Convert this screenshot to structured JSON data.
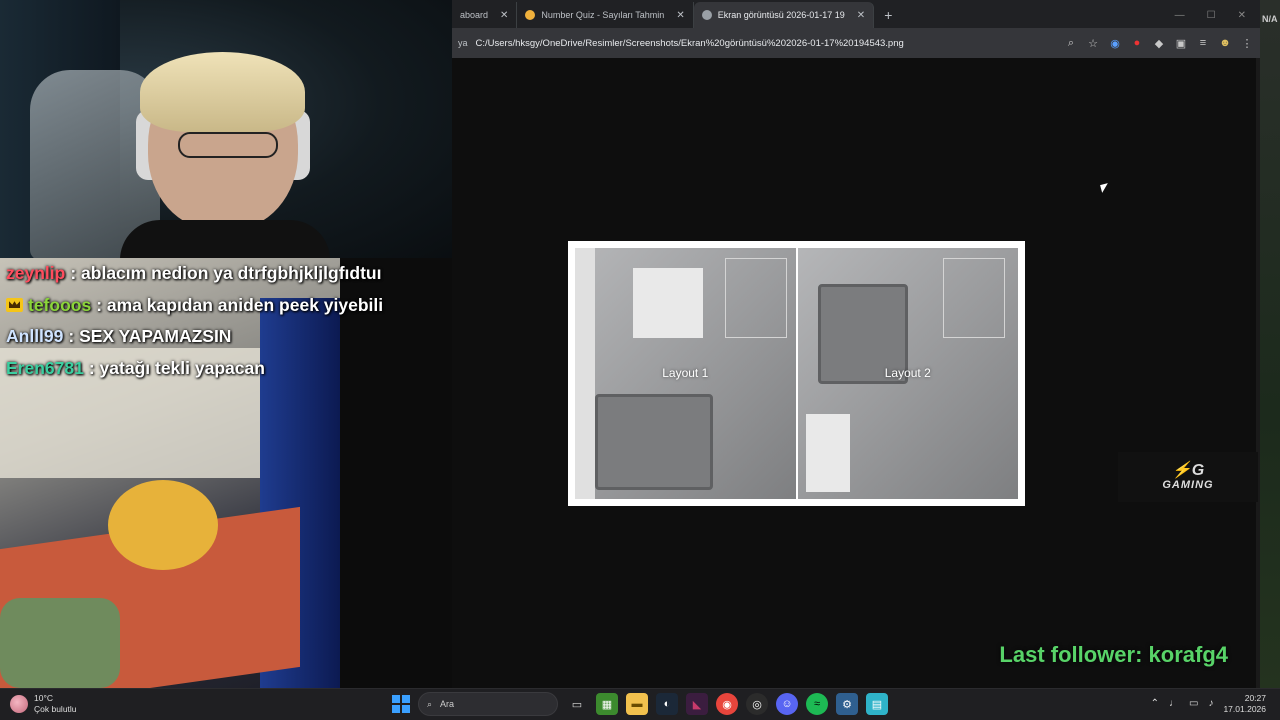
{
  "chat": [
    {
      "user": "zeynlip",
      "color": "#ff4d5e",
      "separator": ":",
      "message": "ablacım nedion ya dtrfgbhjkljlgfıdtuı",
      "badge": false
    },
    {
      "user": "tefooos",
      "color": "#8bd53a",
      "separator": ":",
      "message": "ama kapıdan aniden peek yiyebili",
      "badge": true
    },
    {
      "user": "Anlll99",
      "color": "#cfe3ff",
      "separator": ":",
      "message": "SEX YAPAMAZSIN",
      "badge": false
    },
    {
      "user": "Eren6781",
      "color": "#3ccfa0",
      "separator": ":",
      "message": "yatağı tekli yapacan",
      "badge": false
    }
  ],
  "browser": {
    "tabs": [
      {
        "label": "aboard",
        "active": false
      },
      {
        "label": "Number Quiz - Sayıları Tahmin",
        "active": false
      },
      {
        "label": "Ekran görüntüsü 2026-01-17 19",
        "active": true
      }
    ],
    "new_tab": "+",
    "close": "✕",
    "window_controls": {
      "minimize": "—",
      "maximize": "☐",
      "close": "✕"
    },
    "address_prefix": "ya",
    "url": "C:/Users/hksgy/OneDrive/Resimler/Screenshots/Ekran%20görüntüsü%202026-01-17%20194543.png"
  },
  "image": {
    "layout1": "Layout 1",
    "layout2": "Layout 2"
  },
  "overlay": {
    "last_follower": "Last follower: korafg4",
    "logo_mark": "⚡G",
    "logo_text": "GAMING",
    "edge_text": "N/A"
  },
  "taskbar": {
    "weather_temp": "10°C",
    "weather_desc": "Çok bulutlu",
    "search_placeholder": "Ara",
    "time": "20:27",
    "date": "17.01.2026"
  }
}
